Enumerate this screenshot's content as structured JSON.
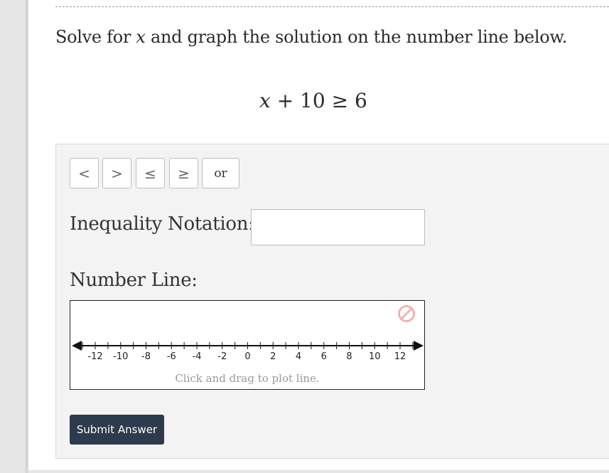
{
  "question": {
    "prompt_before": "Solve for ",
    "prompt_var": "x",
    "prompt_after": " and graph the solution on the number line below.",
    "equation_var": "x",
    "equation_rest": " + 10 ≥ 6"
  },
  "toolbar": {
    "buttons": [
      {
        "label": "<",
        "icon": "less-than-icon"
      },
      {
        "label": ">",
        "icon": "greater-than-icon"
      },
      {
        "label": "≤",
        "icon": "less-equal-icon"
      },
      {
        "label": "≥",
        "icon": "greater-equal-icon"
      },
      {
        "label": "or",
        "icon": ""
      }
    ]
  },
  "answer": {
    "inequality_label": "Inequality Notation:",
    "inequality_value": "",
    "number_line_label": "Number Line:",
    "number_line_hint": "Click and drag to plot line.",
    "submit_label": "Submit Answer"
  },
  "number_line": {
    "min": -13,
    "max": 13,
    "tick_step": 1,
    "tick_labels": [
      -12,
      -10,
      -8,
      -6,
      -4,
      -2,
      0,
      2,
      4,
      6,
      8,
      10,
      12
    ],
    "clear_icon": "no-symbol-icon",
    "clear_icon_color": "#f2b3b3"
  },
  "colors": {
    "submit_bg": "#2e3a4d",
    "panel_bg": "#f3f3f4"
  }
}
